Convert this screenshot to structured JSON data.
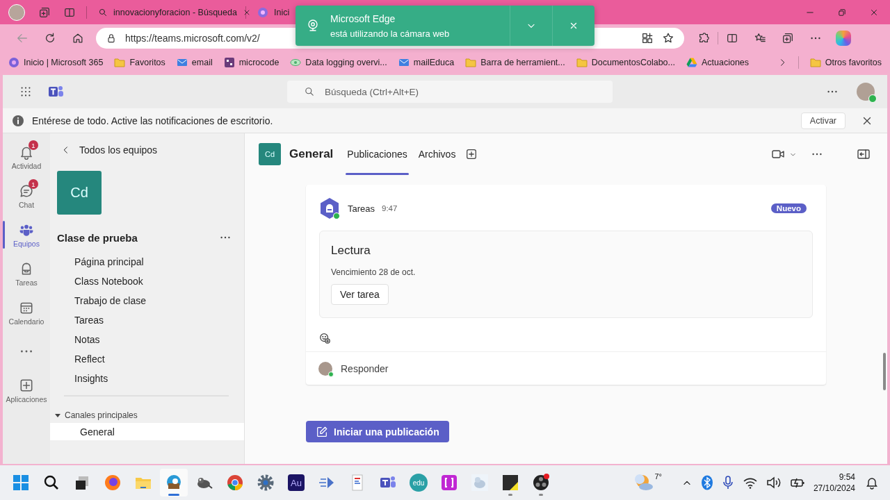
{
  "browser": {
    "tabs": [
      {
        "label": "innovacionyforacion - Búsqueda",
        "kind": "search",
        "selected": false
      },
      {
        "label": "Inici",
        "kind": "app",
        "selected": false
      }
    ],
    "address": "https://teams.microsoft.com/v2/",
    "favorites": [
      {
        "label": "Inicio | Microsoft 365",
        "kind": "ms365"
      },
      {
        "label": "Favoritos",
        "kind": "folder"
      },
      {
        "label": "email",
        "kind": "mail"
      },
      {
        "label": "microcode",
        "kind": "app"
      },
      {
        "label": "Data logging overvi...",
        "kind": "link"
      },
      {
        "label": "mailEduca",
        "kind": "mail"
      },
      {
        "label": "Barra de herramient...",
        "kind": "folder"
      },
      {
        "label": "DocumentosColabo...",
        "kind": "folder"
      },
      {
        "label": "Actuaciones",
        "kind": "drive"
      }
    ],
    "other_favorites": "Otros favoritos"
  },
  "toast": {
    "title": "Microsoft Edge",
    "message": "está utilizando la cámara web"
  },
  "teams": {
    "search": {
      "placeholder": "Búsqueda (Ctrl+Alt+E)"
    },
    "banner": {
      "text": "Entérese de todo. Active las notificaciones de escritorio.",
      "button": "Activar"
    },
    "rail": [
      {
        "kind": "bell",
        "label": "Actividad",
        "badge": "1",
        "selected": false
      },
      {
        "kind": "chat",
        "label": "Chat",
        "badge": "1",
        "selected": false
      },
      {
        "kind": "people",
        "label": "Equipos",
        "selected": true
      },
      {
        "kind": "backpack",
        "label": "Tareas",
        "selected": false
      },
      {
        "kind": "calendar",
        "label": "Calendario",
        "selected": false
      },
      {
        "kind": "more",
        "selected": false
      },
      {
        "kind": "apps",
        "label": "Aplicaciones",
        "selected": false
      }
    ],
    "back_link": "Todos los equipos",
    "team": {
      "initials": "Cd",
      "name": "Clase de prueba",
      "items": [
        "Página principal",
        "Class Notebook",
        "Trabajo de clase",
        "Tareas",
        "Notas",
        "Reflect",
        "Insights"
      ]
    },
    "sections": [
      {
        "label": "Canales principales",
        "expanded": true,
        "channels": [
          {
            "label": "General",
            "selected": true
          }
        ]
      }
    ],
    "channel": {
      "initials": "Cd",
      "name": "General",
      "tabs": [
        {
          "label": "Publicaciones",
          "selected": true
        },
        {
          "label": "Archivos",
          "selected": false
        }
      ]
    },
    "post": {
      "author": "Tareas",
      "time": "9:47",
      "badge": "Nuevo",
      "card": {
        "title": "Lectura",
        "due": "Vencimiento 28 de oct.",
        "button": "Ver tarea"
      },
      "reply": "Responder"
    },
    "new_post": "Iniciar una publicación"
  },
  "taskbar": {
    "apps": [
      {
        "kind": "start",
        "running": false,
        "selected": false
      },
      {
        "kind": "search",
        "running": false,
        "selected": false
      },
      {
        "kind": "taskview",
        "running": false,
        "selected": false
      },
      {
        "kind": "fox",
        "running": false,
        "selected": false
      },
      {
        "kind": "folder",
        "running": false,
        "selected": false
      },
      {
        "kind": "edge",
        "running": true,
        "selected": true
      },
      {
        "kind": "animal",
        "running": false,
        "selected": false
      },
      {
        "kind": "chrome",
        "running": false,
        "selected": false
      },
      {
        "kind": "gear",
        "running": false,
        "selected": false
      },
      {
        "kind": "tile",
        "label": "Au",
        "running": false,
        "selected": false
      },
      {
        "kind": "arrow",
        "running": false,
        "selected": false
      },
      {
        "kind": "doc",
        "running": false,
        "selected": false
      },
      {
        "kind": "teams",
        "running": false,
        "selected": false
      },
      {
        "kind": "edu",
        "label": "edu",
        "running": false,
        "selected": false
      },
      {
        "kind": "bracket",
        "running": false,
        "selected": false
      },
      {
        "kind": "seal",
        "running": false,
        "selected": false
      },
      {
        "kind": "note",
        "running": true,
        "selected": false
      },
      {
        "kind": "rec",
        "running": true,
        "selected": false
      }
    ],
    "weather": "7°",
    "time": "9:54",
    "date": "27/10/2024"
  }
}
